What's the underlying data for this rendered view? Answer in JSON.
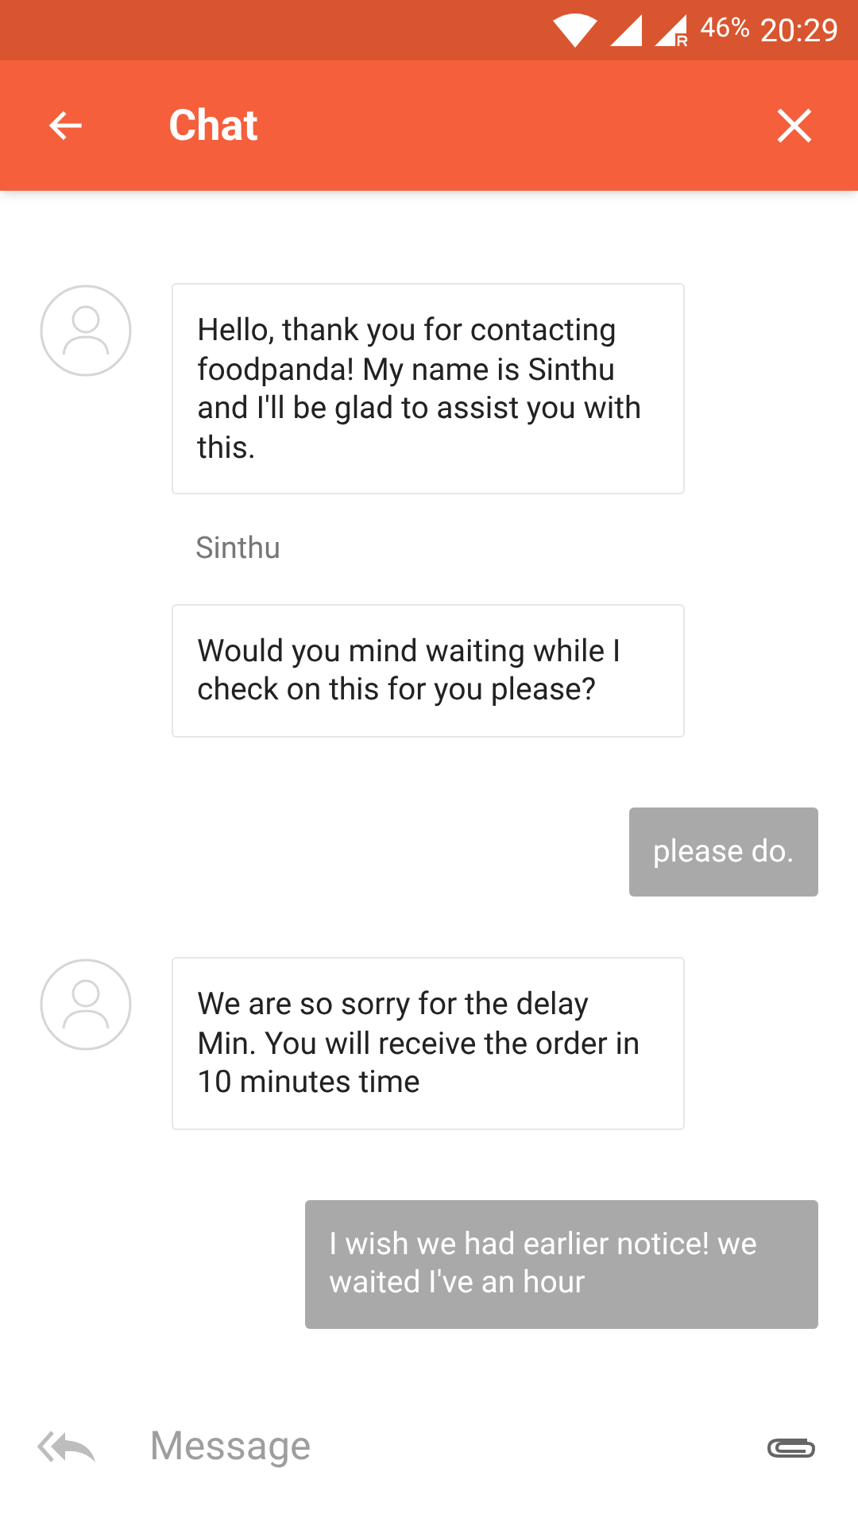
{
  "status_bar": {
    "battery": "46%",
    "time": "20:29"
  },
  "header": {
    "title": "Chat"
  },
  "messages": [
    {
      "kind": "agent",
      "avatar": true,
      "text": "Hello, thank you for contacting foodpanda! My name is Sinthu and I'll be glad to assist you with this."
    },
    {
      "kind": "name",
      "text": "Sinthu"
    },
    {
      "kind": "agent",
      "avatar": false,
      "text": "Would you mind waiting while I check on this for you please?"
    },
    {
      "kind": "user",
      "text": "please do."
    },
    {
      "kind": "agent",
      "avatar": true,
      "text": "We are so sorry for the delay Min. You will receive the order in 10 minutes time"
    },
    {
      "kind": "user",
      "text": "I wish we had earlier notice! we waited I've an hour"
    }
  ],
  "composer": {
    "placeholder": "Message"
  }
}
